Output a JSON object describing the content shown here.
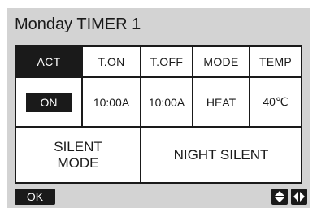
{
  "title": "Monday TIMER 1",
  "columns": [
    "ACT",
    "T.ON",
    "T.OFF",
    "MODE",
    "TEMP"
  ],
  "row": {
    "act": "ON",
    "t_on": "10:00A",
    "t_off": "10:00A",
    "mode": "HEAT",
    "temp": "40℃"
  },
  "silent_mode": {
    "line1": "SILENT",
    "line2": "MODE"
  },
  "night_silent": "NIGHT SILENT",
  "footer": {
    "ok_label": "OK",
    "up_down_icon": "up-down-arrow-icon",
    "left_right_icon": "left-right-arrow-icon"
  },
  "colors": {
    "panel_bg": "#d3d3d3",
    "dark": "#1a1a1a",
    "cell_bg": "#ffffff"
  }
}
